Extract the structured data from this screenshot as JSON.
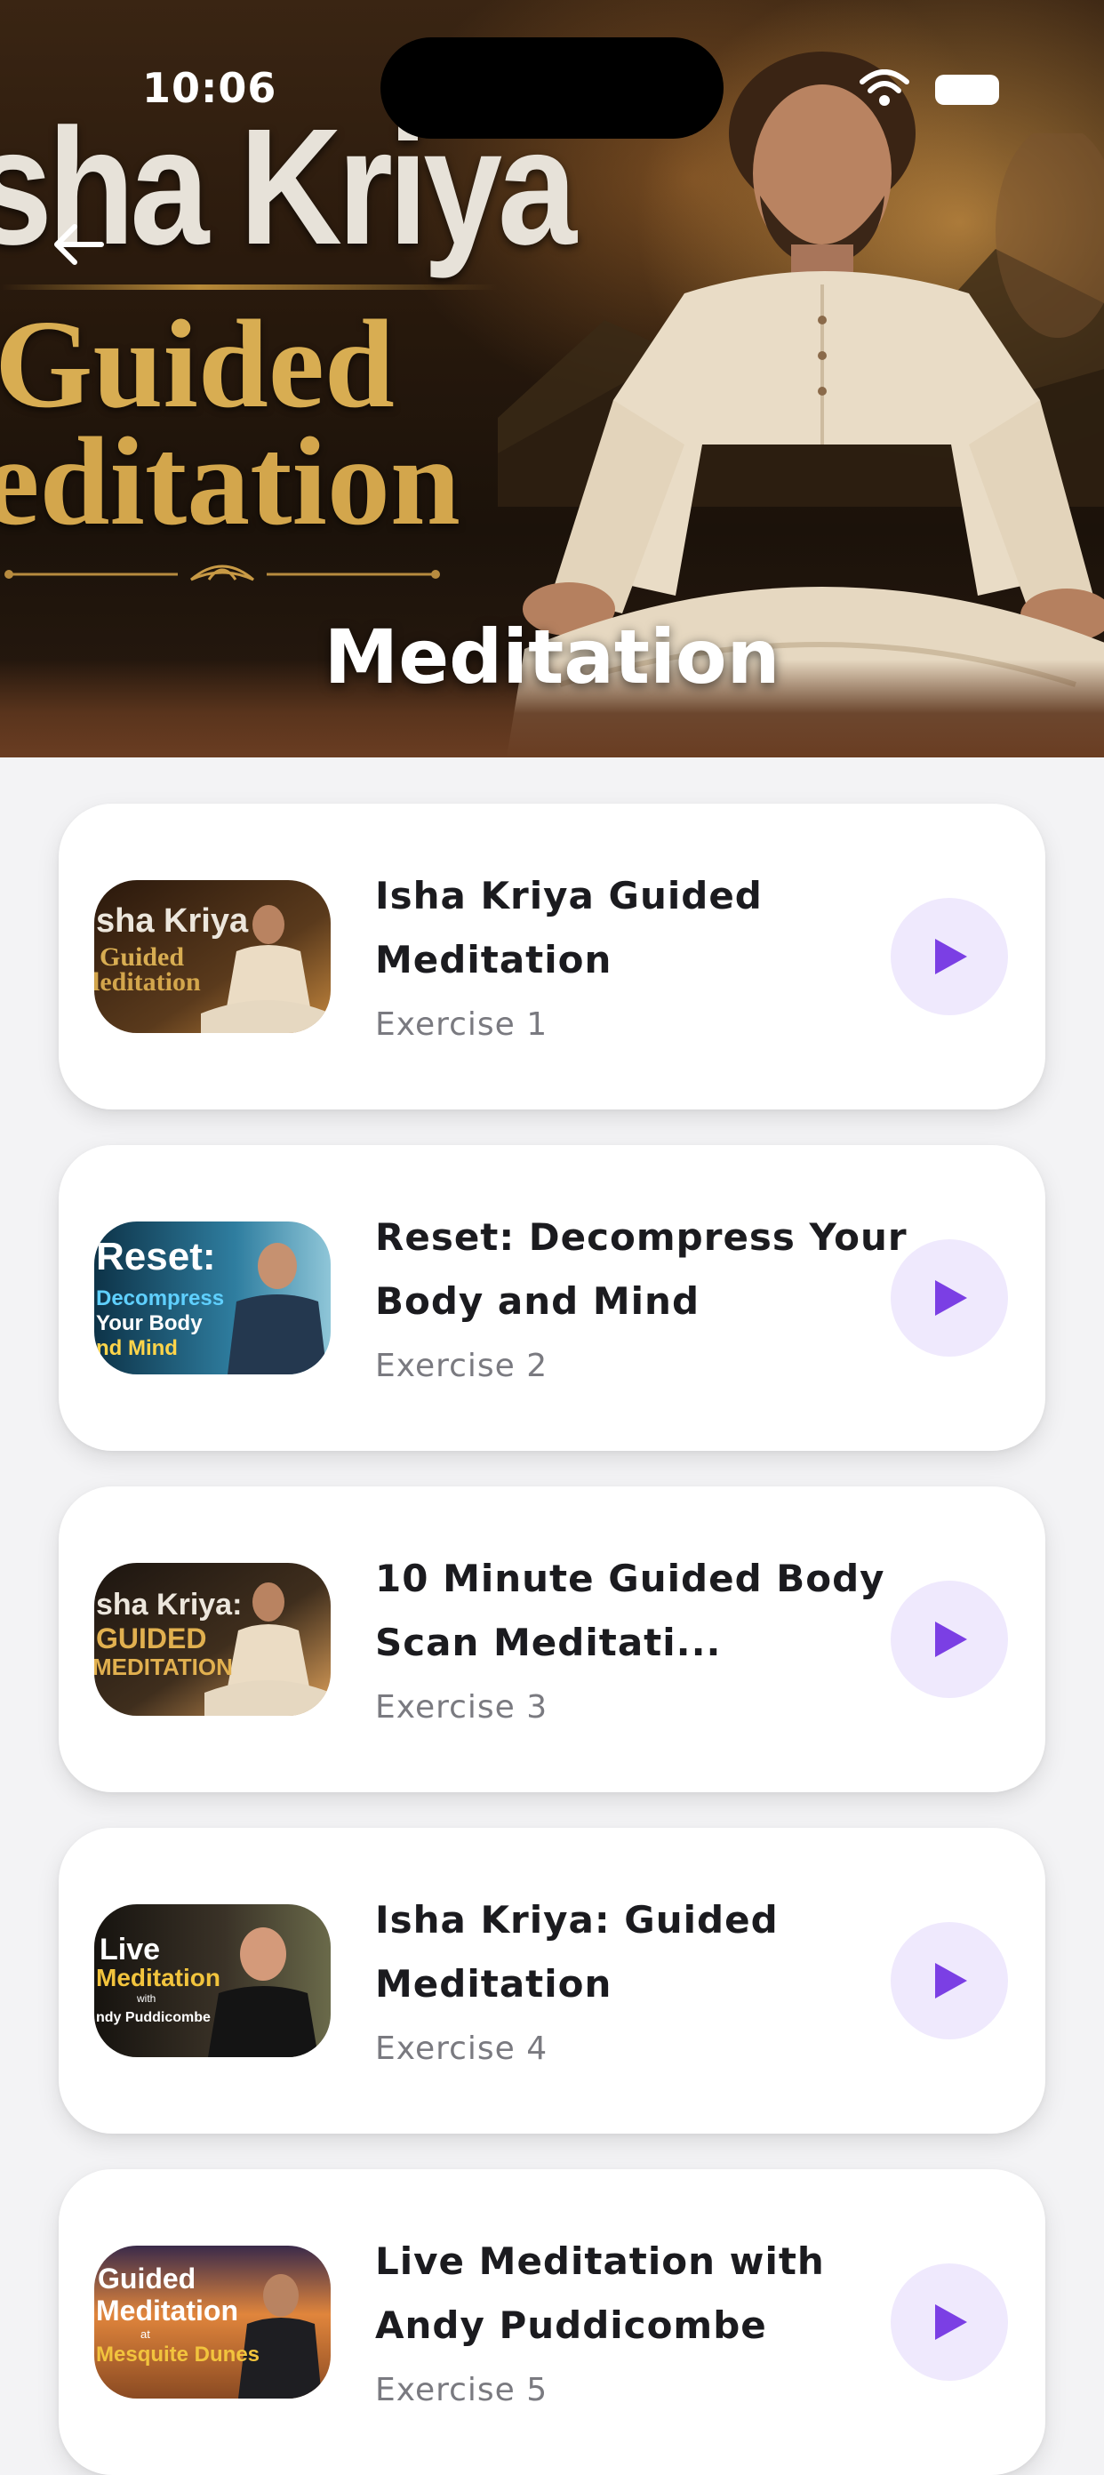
{
  "status_bar": {
    "time": "10:06"
  },
  "hero": {
    "title_line_1": "sha Kriya",
    "title_line_2": "Guided",
    "title_line_3": "leditation",
    "label": "Meditation"
  },
  "colors": {
    "accent_play": "#7b3fe4",
    "play_bg": "#efe9fd",
    "card_bg": "#ffffff",
    "page_bg": "#f3f3f5"
  },
  "exercises": [
    {
      "title": "Isha Kriya Guided Meditation",
      "subtitle": "Exercise 1",
      "thumb_lines": [
        "sha Kriya",
        "Guided",
        "leditation"
      ]
    },
    {
      "title": "Reset: Decompress Your Body and Mind",
      "subtitle": "Exercise 2",
      "thumb_lines": [
        "Reset:",
        "Decompress",
        "Your Body",
        "nd Mind"
      ]
    },
    {
      "title": "10 Minute Guided Body Scan Meditati...",
      "subtitle": "Exercise 3",
      "thumb_lines": [
        "sha Kriya:",
        "GUIDED",
        "MEDITATION"
      ]
    },
    {
      "title": "Isha Kriya: Guided Meditation",
      "subtitle": "Exercise 4",
      "thumb_lines": [
        "Live",
        "Meditation",
        "with",
        "ndy Puddicombe"
      ]
    },
    {
      "title": "Live Meditation with Andy Puddicombe",
      "subtitle": "Exercise 5",
      "thumb_lines": [
        "Guided",
        "Meditation",
        "at",
        "Mesquite Dunes"
      ]
    }
  ]
}
